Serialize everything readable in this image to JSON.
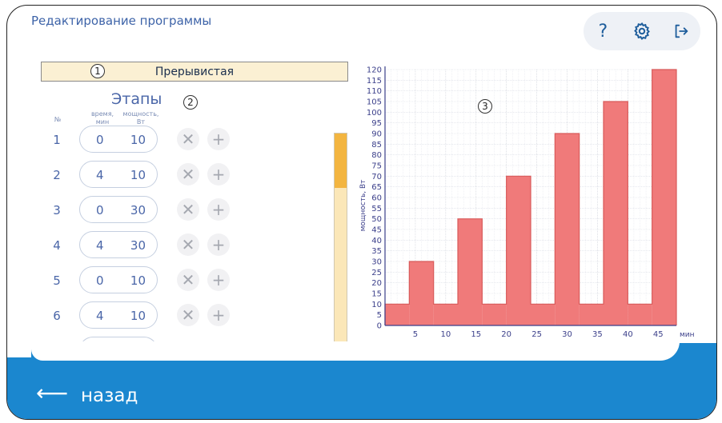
{
  "header": {
    "title": "Редактирование программы",
    "help_glyph": "?",
    "settings_icon": "gear-icon",
    "exit_icon": "logout-icon"
  },
  "mode": {
    "label": "Прерывистая"
  },
  "callouts": {
    "c1": "1",
    "c2": "2",
    "c3": "3"
  },
  "stages": {
    "title": "Этапы",
    "col_num": "№",
    "col_time": "время, мин",
    "col_power": "мощность, Вт",
    "rows": [
      {
        "n": "1",
        "time": "0",
        "power": "10"
      },
      {
        "n": "2",
        "time": "4",
        "power": "10"
      },
      {
        "n": "3",
        "time": "0",
        "power": "30"
      },
      {
        "n": "4",
        "time": "4",
        "power": "30"
      },
      {
        "n": "5",
        "time": "0",
        "power": "10"
      },
      {
        "n": "6",
        "time": "4",
        "power": "10"
      }
    ],
    "scroll_position": 0.25
  },
  "footer": {
    "back_label": "назад",
    "back_icon": "arrow-left-icon"
  },
  "colors": {
    "accent": "#1b87cf",
    "bar": "#f07a7a",
    "mode_bg": "#fbf0d3",
    "scroll_thumb": "#f3b540"
  },
  "chart_data": {
    "type": "bar",
    "ylabel": "мощность, Вт",
    "xlabel": "мин",
    "xlim": [
      0,
      48
    ],
    "ylim": [
      0,
      120
    ],
    "x_ticks": [
      5,
      10,
      15,
      20,
      25,
      30,
      35,
      40,
      45
    ],
    "y_ticks": [
      0,
      5,
      10,
      15,
      20,
      25,
      30,
      35,
      40,
      45,
      50,
      55,
      60,
      65,
      70,
      75,
      80,
      85,
      90,
      95,
      100,
      105,
      110,
      115,
      120
    ],
    "grid": true,
    "segments": [
      {
        "start": 0,
        "end": 4,
        "value": 10
      },
      {
        "start": 4,
        "end": 8,
        "value": 30
      },
      {
        "start": 8,
        "end": 12,
        "value": 10
      },
      {
        "start": 12,
        "end": 16,
        "value": 50
      },
      {
        "start": 16,
        "end": 20,
        "value": 10
      },
      {
        "start": 20,
        "end": 24,
        "value": 70
      },
      {
        "start": 24,
        "end": 28,
        "value": 10
      },
      {
        "start": 28,
        "end": 32,
        "value": 90
      },
      {
        "start": 32,
        "end": 36,
        "value": 10
      },
      {
        "start": 36,
        "end": 40,
        "value": 105
      },
      {
        "start": 40,
        "end": 44,
        "value": 10
      },
      {
        "start": 44,
        "end": 48,
        "value": 120
      }
    ]
  }
}
